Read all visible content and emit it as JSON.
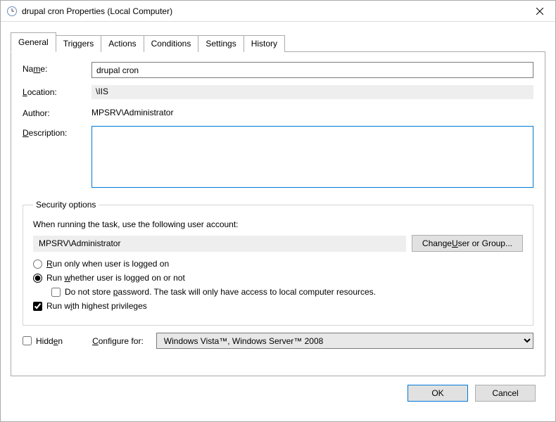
{
  "window": {
    "title": "drupal cron Properties (Local Computer)"
  },
  "tabs": {
    "general": "General",
    "triggers": "Triggers",
    "actions": "Actions",
    "conditions": "Conditions",
    "settings": "Settings",
    "history": "History"
  },
  "general": {
    "name_label_pre": "Na",
    "name_label_u": "m",
    "name_label_post": "e:",
    "name_value": "drupal cron",
    "location_label_u": "L",
    "location_label_post": "ocation:",
    "location_value": "\\IIS",
    "author_label": "Author:",
    "author_value": "MPSRV\\Administrator",
    "description_label_u": "D",
    "description_label_post": "escription:",
    "description_value": ""
  },
  "security": {
    "legend": "Security options",
    "running_text": "When running the task, use the following user account:",
    "account_value": "MPSRV\\Administrator",
    "change_user_pre": "Change ",
    "change_user_u": "U",
    "change_user_post": "ser or Group...",
    "radio_loggedon_u": "R",
    "radio_loggedon_post": "un only when user is logged on",
    "radio_whether_pre": "Run ",
    "radio_whether_u": "w",
    "radio_whether_post": "hether user is logged on or not",
    "nostore_pre": "Do not store ",
    "nostore_u": "p",
    "nostore_post": "assword.  The task will only have access to local computer resources.",
    "highest_pre": "Run w",
    "highest_u": "i",
    "highest_post": "th highest privileges"
  },
  "bottom": {
    "hidden_pre": "Hidd",
    "hidden_u": "e",
    "hidden_post": "n",
    "configure_label_u": "C",
    "configure_label_post": "onfigure for:",
    "configure_value": "Windows Vista™, Windows Server™ 2008"
  },
  "footer": {
    "ok": "OK",
    "cancel": "Cancel"
  }
}
